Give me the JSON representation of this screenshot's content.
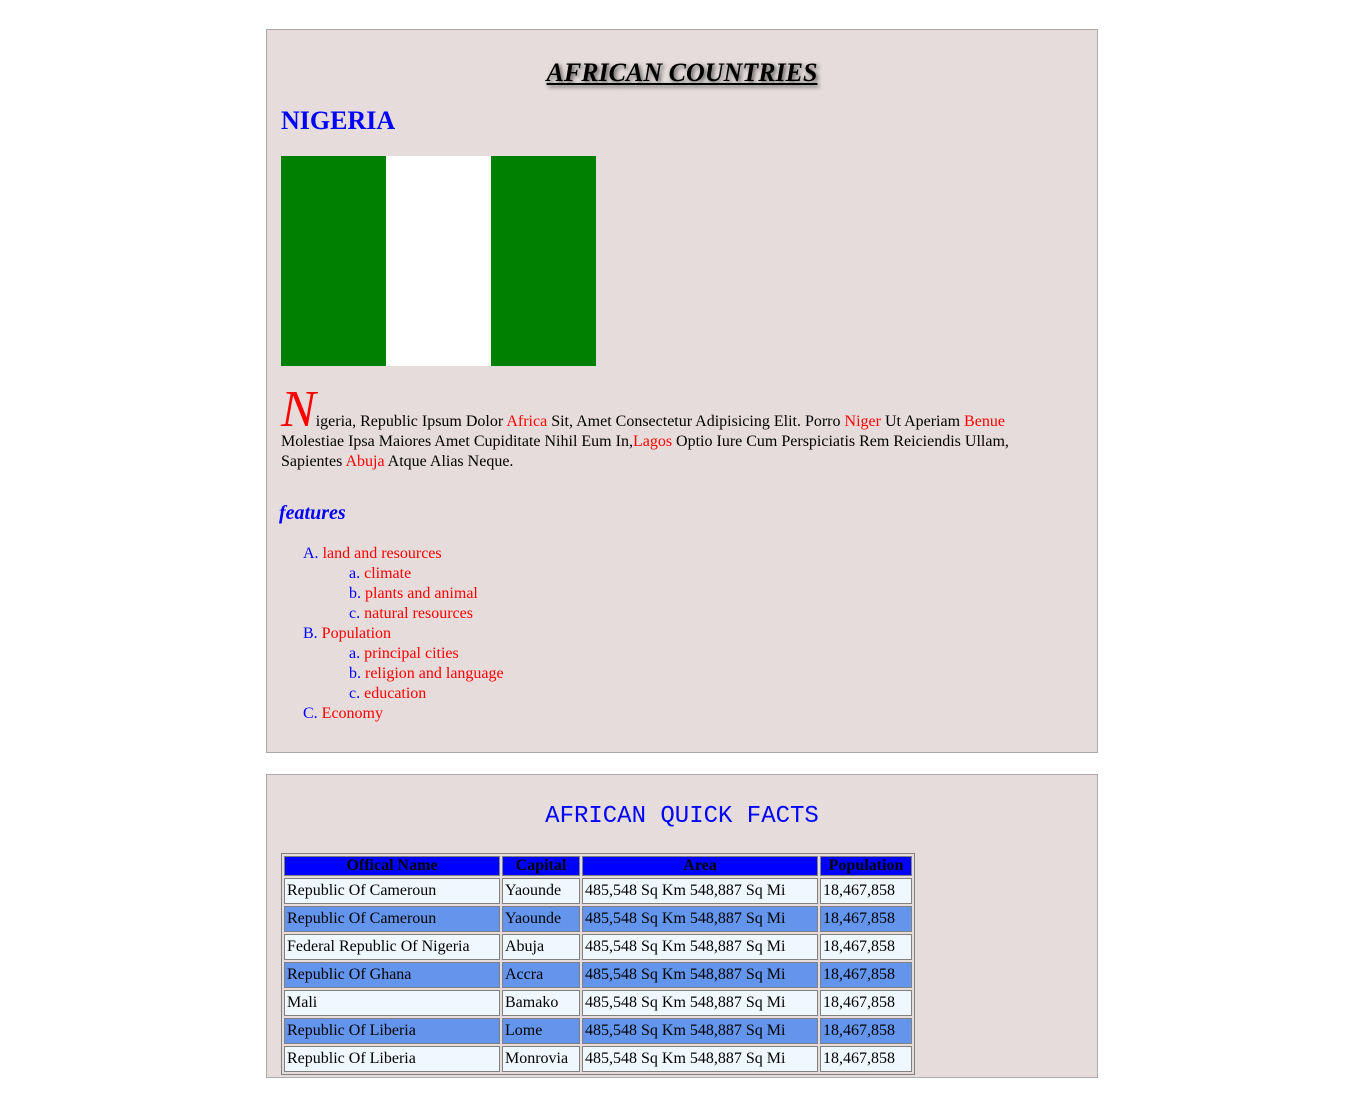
{
  "header": {
    "title": "AFRICAN COUNTRIES",
    "country": "NIGERIA"
  },
  "flag": {
    "description_icon": "nigeria-flag",
    "colors": {
      "green": "#008000",
      "white": "#ffffff"
    }
  },
  "intro": {
    "drop_cap": "N",
    "seg1": "igeria, Republic Ipsum Dolor ",
    "kw1": "Africa",
    "seg2": " Sit, Amet Consectetur Adipisicing Elit. Porro ",
    "kw2": "Niger",
    "seg3": " Ut Aperiam ",
    "kw3": "Benue",
    "seg4": " Molestiae Ipsa Maiores Amet Cupiditate Nihil Eum In,",
    "kw4": "Lagos",
    "seg5": " Optio Iure Cum Perspiciatis Rem Reiciendis Ullam, Sapientes ",
    "kw5": "Abuja",
    "seg6": " Atque Alias Neque."
  },
  "features": {
    "title": "features",
    "items": [
      {
        "marker": "A.",
        "label": "land and resources",
        "sub": [
          {
            "marker": "a.",
            "label": "climate"
          },
          {
            "marker": "b.",
            "label": "plants and animal"
          },
          {
            "marker": "c.",
            "label": "natural resources"
          }
        ]
      },
      {
        "marker": "B.",
        "label": "Population",
        "sub": [
          {
            "marker": "a.",
            "label": "principal cities"
          },
          {
            "marker": "b.",
            "label": "religion and language"
          },
          {
            "marker": "c.",
            "label": "education"
          }
        ]
      },
      {
        "marker": "C.",
        "label": "Economy",
        "sub": []
      }
    ]
  },
  "quick_facts": {
    "title": "AFRICAN QUICK FACTS",
    "headers": [
      "Offical Name",
      "Capital",
      "Area",
      "Population"
    ],
    "rows": [
      [
        "Republic Of Cameroun",
        "Yaounde",
        "485,548 Sq Km 548,887 Sq Mi",
        "18,467,858"
      ],
      [
        "Republic Of Cameroun",
        "Yaounde",
        "485,548 Sq Km 548,887 Sq Mi",
        "18,467,858"
      ],
      [
        "Federal Republic Of Nigeria",
        "Abuja",
        "485,548 Sq Km 548,887 Sq Mi",
        "18,467,858"
      ],
      [
        "Republic Of Ghana",
        "Accra",
        "485,548 Sq Km 548,887 Sq Mi",
        "18,467,858"
      ],
      [
        "Mali",
        "Bamako",
        "485,548 Sq Km 548,887 Sq Mi",
        "18,467,858"
      ],
      [
        "Republic Of Liberia",
        "Lome",
        "485,548 Sq Km 548,887 Sq Mi",
        "18,467,858"
      ],
      [
        "Republic Of Liberia",
        "Monrovia",
        "485,548 Sq Km 548,887 Sq Mi",
        "18,467,858"
      ]
    ],
    "colors": {
      "header": "#0000ff",
      "row_light": "#f0f8ff",
      "row_dark": "#6495ed"
    }
  }
}
